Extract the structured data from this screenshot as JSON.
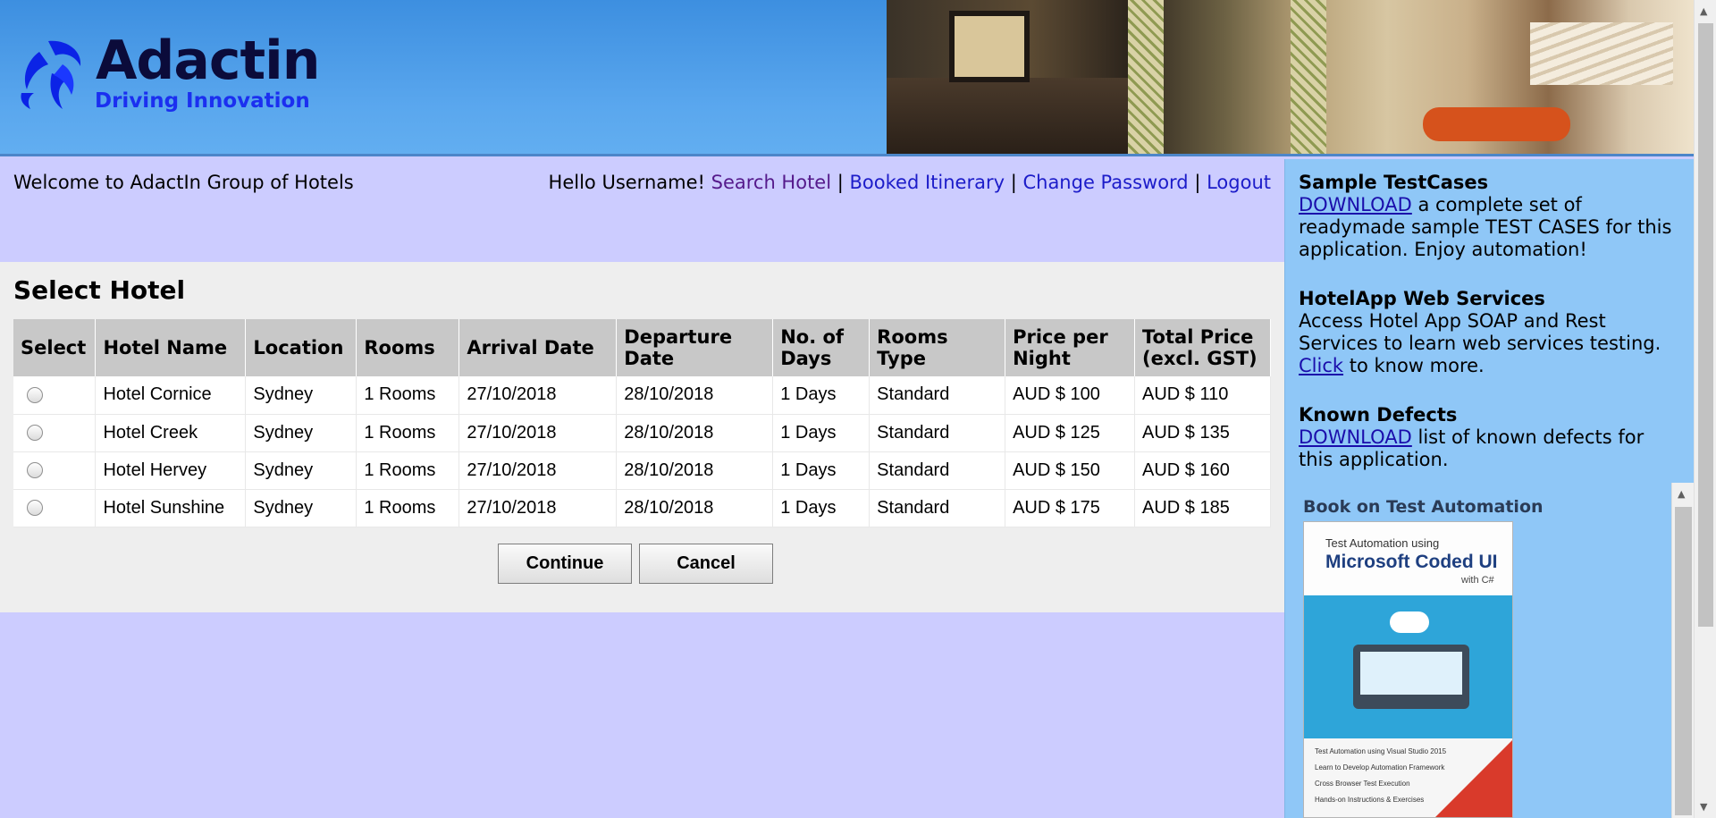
{
  "header": {
    "logo_name": "Adactin",
    "logo_tagline": "Driving Innovation",
    "banner_icon": "hotel-lobby-image"
  },
  "topbar": {
    "welcome": "Welcome to AdactIn Group of Hotels",
    "greeting": "Hello Username!",
    "links": {
      "search_hotel": "Search Hotel",
      "booked_itinerary": "Booked Itinerary",
      "change_password": "Change Password",
      "logout": "Logout"
    },
    "separator": "|"
  },
  "main": {
    "title": "Select Hotel",
    "columns": [
      "Select",
      "Hotel Name",
      "Location",
      "Rooms",
      "Arrival Date",
      "Departure Date",
      "No. of Days",
      "Rooms Type",
      "Price per Night",
      "Total Price (excl. GST)"
    ],
    "rows": [
      {
        "hotel": "Hotel Cornice",
        "location": "Sydney",
        "rooms": "1 Rooms",
        "arrival": "27/10/2018",
        "departure": "28/10/2018",
        "days": "1 Days",
        "type": "Standard",
        "price": "AUD $ 100",
        "total": "AUD $ 110"
      },
      {
        "hotel": "Hotel Creek",
        "location": "Sydney",
        "rooms": "1 Rooms",
        "arrival": "27/10/2018",
        "departure": "28/10/2018",
        "days": "1 Days",
        "type": "Standard",
        "price": "AUD $ 125",
        "total": "AUD $ 135"
      },
      {
        "hotel": "Hotel Hervey",
        "location": "Sydney",
        "rooms": "1 Rooms",
        "arrival": "27/10/2018",
        "departure": "28/10/2018",
        "days": "1 Days",
        "type": "Standard",
        "price": "AUD $ 150",
        "total": "AUD $ 160"
      },
      {
        "hotel": "Hotel Sunshine",
        "location": "Sydney",
        "rooms": "1 Rooms",
        "arrival": "27/10/2018",
        "departure": "28/10/2018",
        "days": "1 Days",
        "type": "Standard",
        "price": "AUD $ 175",
        "total": "AUD $ 185"
      }
    ],
    "continue_label": "Continue",
    "cancel_label": "Cancel"
  },
  "sidebar": {
    "testcases": {
      "title": "Sample TestCases",
      "link": "DOWNLOAD",
      "text": " a complete set of readymade sample TEST CASES for this application. Enjoy automation!"
    },
    "webservices": {
      "title": "HotelApp Web Services",
      "text": "Access Hotel App SOAP and Rest Services to learn web services testing.",
      "link": "Click",
      "text_after": " to know more."
    },
    "defects": {
      "title": "Known Defects",
      "link": "DOWNLOAD",
      "text": " list of known defects for this application."
    },
    "book": {
      "title": "Book on Test Automation",
      "cover_line1": "Test Automation using",
      "cover_line2": "Microsoft Coded UI",
      "cover_line3": "with C#",
      "list": [
        "Test Automation using Visual Studio 2015",
        "Learn to Develop Automation Framework",
        "Cross Browser Test Execution",
        "Hands-on Instructions & Exercises"
      ]
    }
  },
  "colors": {
    "page_bg": "#ccccff",
    "header_blue": "#4a9be8",
    "sidebar_bg": "#8fc7f7",
    "panel_bg": "#eeeeee",
    "link": "#1c1cc9",
    "visited_link": "#551a8b"
  }
}
